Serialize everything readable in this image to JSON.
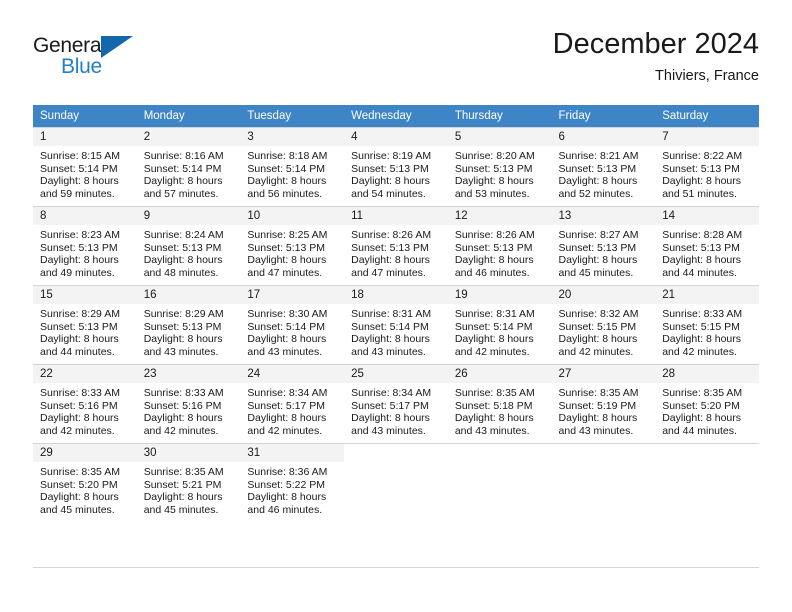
{
  "brand": {
    "name_part1": "General",
    "name_part2": "Blue",
    "triangle_color": "#1567ad",
    "blue_color": "#2580c3"
  },
  "header": {
    "month_title": "December 2024",
    "location": "Thiviers, France"
  },
  "theme": {
    "header_row_background": "#3d85c6",
    "header_row_text": "#ffffff",
    "daynum_background": "#f3f3f3",
    "grid_line": "#d4d4d4",
    "body_text": "#1a1a1a"
  },
  "calendar": {
    "weekday_headers": [
      "Sunday",
      "Monday",
      "Tuesday",
      "Wednesday",
      "Thursday",
      "Friday",
      "Saturday"
    ],
    "weeks": [
      [
        {
          "day": "1",
          "sunrise": "Sunrise: 8:15 AM",
          "sunset": "Sunset: 5:14 PM",
          "daylight_line1": "Daylight: 8 hours",
          "daylight_line2": "and 59 minutes."
        },
        {
          "day": "2",
          "sunrise": "Sunrise: 8:16 AM",
          "sunset": "Sunset: 5:14 PM",
          "daylight_line1": "Daylight: 8 hours",
          "daylight_line2": "and 57 minutes."
        },
        {
          "day": "3",
          "sunrise": "Sunrise: 8:18 AM",
          "sunset": "Sunset: 5:14 PM",
          "daylight_line1": "Daylight: 8 hours",
          "daylight_line2": "and 56 minutes."
        },
        {
          "day": "4",
          "sunrise": "Sunrise: 8:19 AM",
          "sunset": "Sunset: 5:13 PM",
          "daylight_line1": "Daylight: 8 hours",
          "daylight_line2": "and 54 minutes."
        },
        {
          "day": "5",
          "sunrise": "Sunrise: 8:20 AM",
          "sunset": "Sunset: 5:13 PM",
          "daylight_line1": "Daylight: 8 hours",
          "daylight_line2": "and 53 minutes."
        },
        {
          "day": "6",
          "sunrise": "Sunrise: 8:21 AM",
          "sunset": "Sunset: 5:13 PM",
          "daylight_line1": "Daylight: 8 hours",
          "daylight_line2": "and 52 minutes."
        },
        {
          "day": "7",
          "sunrise": "Sunrise: 8:22 AM",
          "sunset": "Sunset: 5:13 PM",
          "daylight_line1": "Daylight: 8 hours",
          "daylight_line2": "and 51 minutes."
        }
      ],
      [
        {
          "day": "8",
          "sunrise": "Sunrise: 8:23 AM",
          "sunset": "Sunset: 5:13 PM",
          "daylight_line1": "Daylight: 8 hours",
          "daylight_line2": "and 49 minutes."
        },
        {
          "day": "9",
          "sunrise": "Sunrise: 8:24 AM",
          "sunset": "Sunset: 5:13 PM",
          "daylight_line1": "Daylight: 8 hours",
          "daylight_line2": "and 48 minutes."
        },
        {
          "day": "10",
          "sunrise": "Sunrise: 8:25 AM",
          "sunset": "Sunset: 5:13 PM",
          "daylight_line1": "Daylight: 8 hours",
          "daylight_line2": "and 47 minutes."
        },
        {
          "day": "11",
          "sunrise": "Sunrise: 8:26 AM",
          "sunset": "Sunset: 5:13 PM",
          "daylight_line1": "Daylight: 8 hours",
          "daylight_line2": "and 47 minutes."
        },
        {
          "day": "12",
          "sunrise": "Sunrise: 8:26 AM",
          "sunset": "Sunset: 5:13 PM",
          "daylight_line1": "Daylight: 8 hours",
          "daylight_line2": "and 46 minutes."
        },
        {
          "day": "13",
          "sunrise": "Sunrise: 8:27 AM",
          "sunset": "Sunset: 5:13 PM",
          "daylight_line1": "Daylight: 8 hours",
          "daylight_line2": "and 45 minutes."
        },
        {
          "day": "14",
          "sunrise": "Sunrise: 8:28 AM",
          "sunset": "Sunset: 5:13 PM",
          "daylight_line1": "Daylight: 8 hours",
          "daylight_line2": "and 44 minutes."
        }
      ],
      [
        {
          "day": "15",
          "sunrise": "Sunrise: 8:29 AM",
          "sunset": "Sunset: 5:13 PM",
          "daylight_line1": "Daylight: 8 hours",
          "daylight_line2": "and 44 minutes."
        },
        {
          "day": "16",
          "sunrise": "Sunrise: 8:29 AM",
          "sunset": "Sunset: 5:13 PM",
          "daylight_line1": "Daylight: 8 hours",
          "daylight_line2": "and 43 minutes."
        },
        {
          "day": "17",
          "sunrise": "Sunrise: 8:30 AM",
          "sunset": "Sunset: 5:14 PM",
          "daylight_line1": "Daylight: 8 hours",
          "daylight_line2": "and 43 minutes."
        },
        {
          "day": "18",
          "sunrise": "Sunrise: 8:31 AM",
          "sunset": "Sunset: 5:14 PM",
          "daylight_line1": "Daylight: 8 hours",
          "daylight_line2": "and 43 minutes."
        },
        {
          "day": "19",
          "sunrise": "Sunrise: 8:31 AM",
          "sunset": "Sunset: 5:14 PM",
          "daylight_line1": "Daylight: 8 hours",
          "daylight_line2": "and 42 minutes."
        },
        {
          "day": "20",
          "sunrise": "Sunrise: 8:32 AM",
          "sunset": "Sunset: 5:15 PM",
          "daylight_line1": "Daylight: 8 hours",
          "daylight_line2": "and 42 minutes."
        },
        {
          "day": "21",
          "sunrise": "Sunrise: 8:33 AM",
          "sunset": "Sunset: 5:15 PM",
          "daylight_line1": "Daylight: 8 hours",
          "daylight_line2": "and 42 minutes."
        }
      ],
      [
        {
          "day": "22",
          "sunrise": "Sunrise: 8:33 AM",
          "sunset": "Sunset: 5:16 PM",
          "daylight_line1": "Daylight: 8 hours",
          "daylight_line2": "and 42 minutes."
        },
        {
          "day": "23",
          "sunrise": "Sunrise: 8:33 AM",
          "sunset": "Sunset: 5:16 PM",
          "daylight_line1": "Daylight: 8 hours",
          "daylight_line2": "and 42 minutes."
        },
        {
          "day": "24",
          "sunrise": "Sunrise: 8:34 AM",
          "sunset": "Sunset: 5:17 PM",
          "daylight_line1": "Daylight: 8 hours",
          "daylight_line2": "and 42 minutes."
        },
        {
          "day": "25",
          "sunrise": "Sunrise: 8:34 AM",
          "sunset": "Sunset: 5:17 PM",
          "daylight_line1": "Daylight: 8 hours",
          "daylight_line2": "and 43 minutes."
        },
        {
          "day": "26",
          "sunrise": "Sunrise: 8:35 AM",
          "sunset": "Sunset: 5:18 PM",
          "daylight_line1": "Daylight: 8 hours",
          "daylight_line2": "and 43 minutes."
        },
        {
          "day": "27",
          "sunrise": "Sunrise: 8:35 AM",
          "sunset": "Sunset: 5:19 PM",
          "daylight_line1": "Daylight: 8 hours",
          "daylight_line2": "and 43 minutes."
        },
        {
          "day": "28",
          "sunrise": "Sunrise: 8:35 AM",
          "sunset": "Sunset: 5:20 PM",
          "daylight_line1": "Daylight: 8 hours",
          "daylight_line2": "and 44 minutes."
        }
      ],
      [
        {
          "day": "29",
          "sunrise": "Sunrise: 8:35 AM",
          "sunset": "Sunset: 5:20 PM",
          "daylight_line1": "Daylight: 8 hours",
          "daylight_line2": "and 45 minutes."
        },
        {
          "day": "30",
          "sunrise": "Sunrise: 8:35 AM",
          "sunset": "Sunset: 5:21 PM",
          "daylight_line1": "Daylight: 8 hours",
          "daylight_line2": "and 45 minutes."
        },
        {
          "day": "31",
          "sunrise": "Sunrise: 8:36 AM",
          "sunset": "Sunset: 5:22 PM",
          "daylight_line1": "Daylight: 8 hours",
          "daylight_line2": "and 46 minutes."
        },
        {
          "day": "",
          "sunrise": "",
          "sunset": "",
          "daylight_line1": "",
          "daylight_line2": ""
        },
        {
          "day": "",
          "sunrise": "",
          "sunset": "",
          "daylight_line1": "",
          "daylight_line2": ""
        },
        {
          "day": "",
          "sunrise": "",
          "sunset": "",
          "daylight_line1": "",
          "daylight_line2": ""
        },
        {
          "day": "",
          "sunrise": "",
          "sunset": "",
          "daylight_line1": "",
          "daylight_line2": ""
        }
      ]
    ]
  }
}
